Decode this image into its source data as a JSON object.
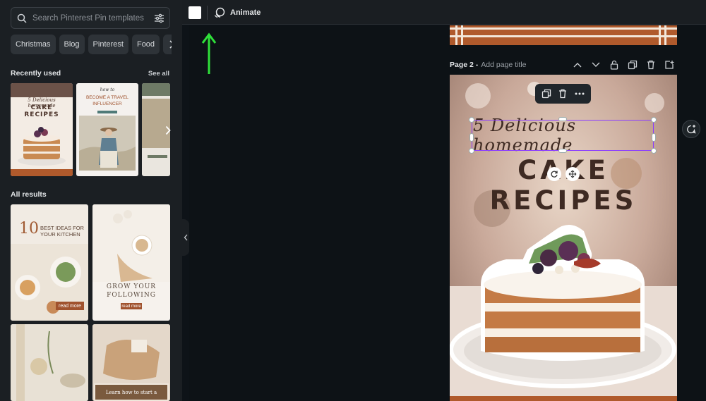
{
  "search": {
    "placeholder": "Search Pinterest Pin templates",
    "icon": "search-icon",
    "filter_icon": "sliders-icon"
  },
  "chips": [
    "Christmas",
    "Blog",
    "Pinterest",
    "Food"
  ],
  "recently_used": {
    "title": "Recently used",
    "see_all": "See all",
    "items": [
      {
        "line1": "5 Delicious homemade",
        "line2": "CAKE RECIPES"
      },
      {
        "line1": "how to",
        "line2": "BECOME A TRAVEL INFLUENCER"
      },
      {
        "line1": "",
        "line2": ""
      }
    ]
  },
  "all_results": {
    "title": "All results",
    "items": [
      {
        "number": "10",
        "line1": "BEST IDEAS FOR",
        "line2": "YOUR KITCHEN",
        "button": "read more"
      },
      {
        "line1": "GROW YOUR",
        "line2": "FOLLOWING",
        "button": "read more"
      },
      {
        "line1": "",
        "line2": ""
      },
      {
        "line1": "Learn how to start a"
      }
    ]
  },
  "topbar": {
    "animate_label": "Animate",
    "color": "#ffffff"
  },
  "page2": {
    "label": "Page 2 -",
    "title_placeholder": "Add page title",
    "design": {
      "script_title": "5 Delicious homemade",
      "big_title": "CAKE RECIPES"
    }
  },
  "colors": {
    "accent": "#8b3dff",
    "arrow": "#2fe03a",
    "brand_brown": "#b05a2c"
  }
}
